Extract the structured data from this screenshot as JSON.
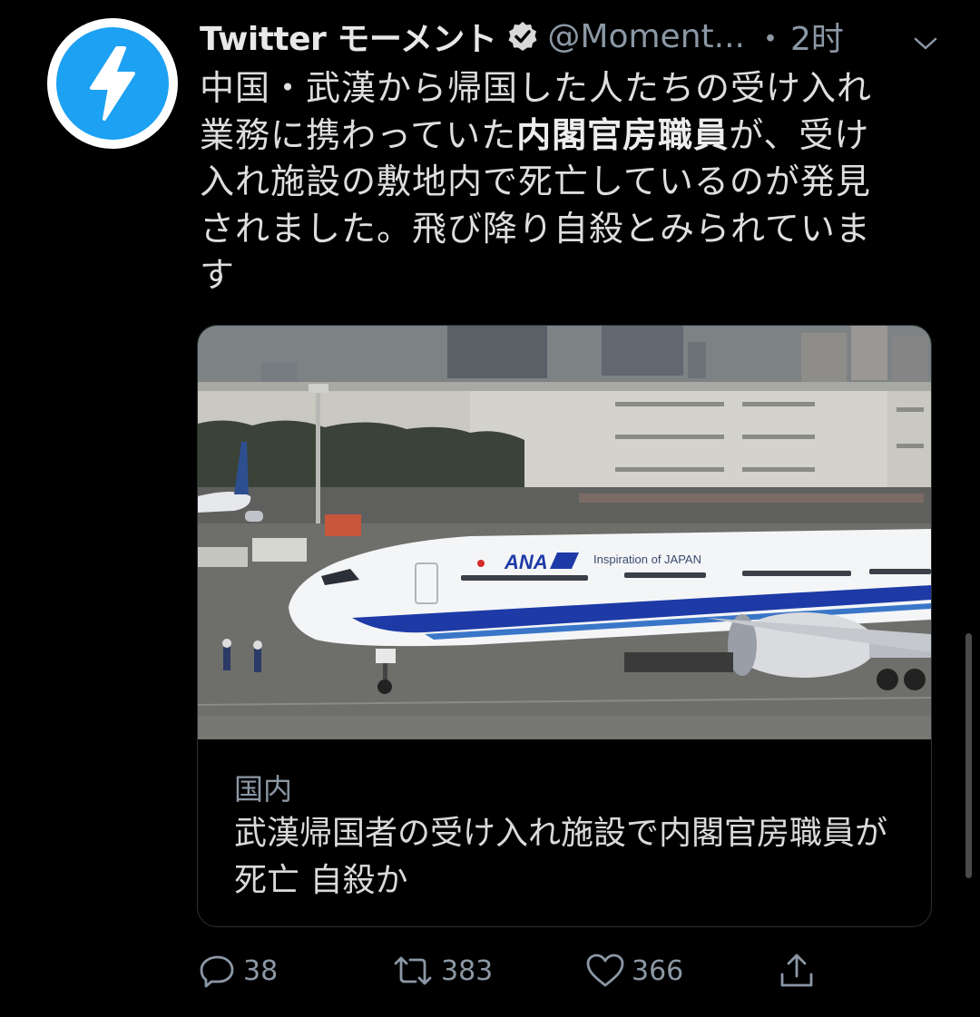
{
  "tweet": {
    "avatar_icon": "lightning-bolt-icon",
    "display_name": "Twitter モーメント",
    "handle": "@Moment...",
    "separator": "・",
    "time": "2时",
    "body_lines": [
      "中国・武漢から帰国した人たちの受け入れ",
      "業務に携わっていた",
      "内閣官房職員",
      "が、受け",
      "入れ施設の敷地内で死亡しているのが発見",
      "されました。飛び降り自殺とみられていま",
      "す"
    ],
    "card": {
      "image_alt": "ANA Inspiration of JAPAN airplane",
      "category": "国内",
      "title": "武漢帰国者の受け入れ施設で内閣官房職員が死亡 自殺か"
    },
    "actions": {
      "reply_count": "38",
      "retweet_count": "383",
      "like_count": "366"
    }
  },
  "colors": {
    "background": "#000000",
    "accent_blue": "#1da1f2",
    "muted_gray": "#8b98a5"
  },
  "airplane": {
    "livery_text": "ANA",
    "slogan": "Inspiration of JAPAN"
  }
}
